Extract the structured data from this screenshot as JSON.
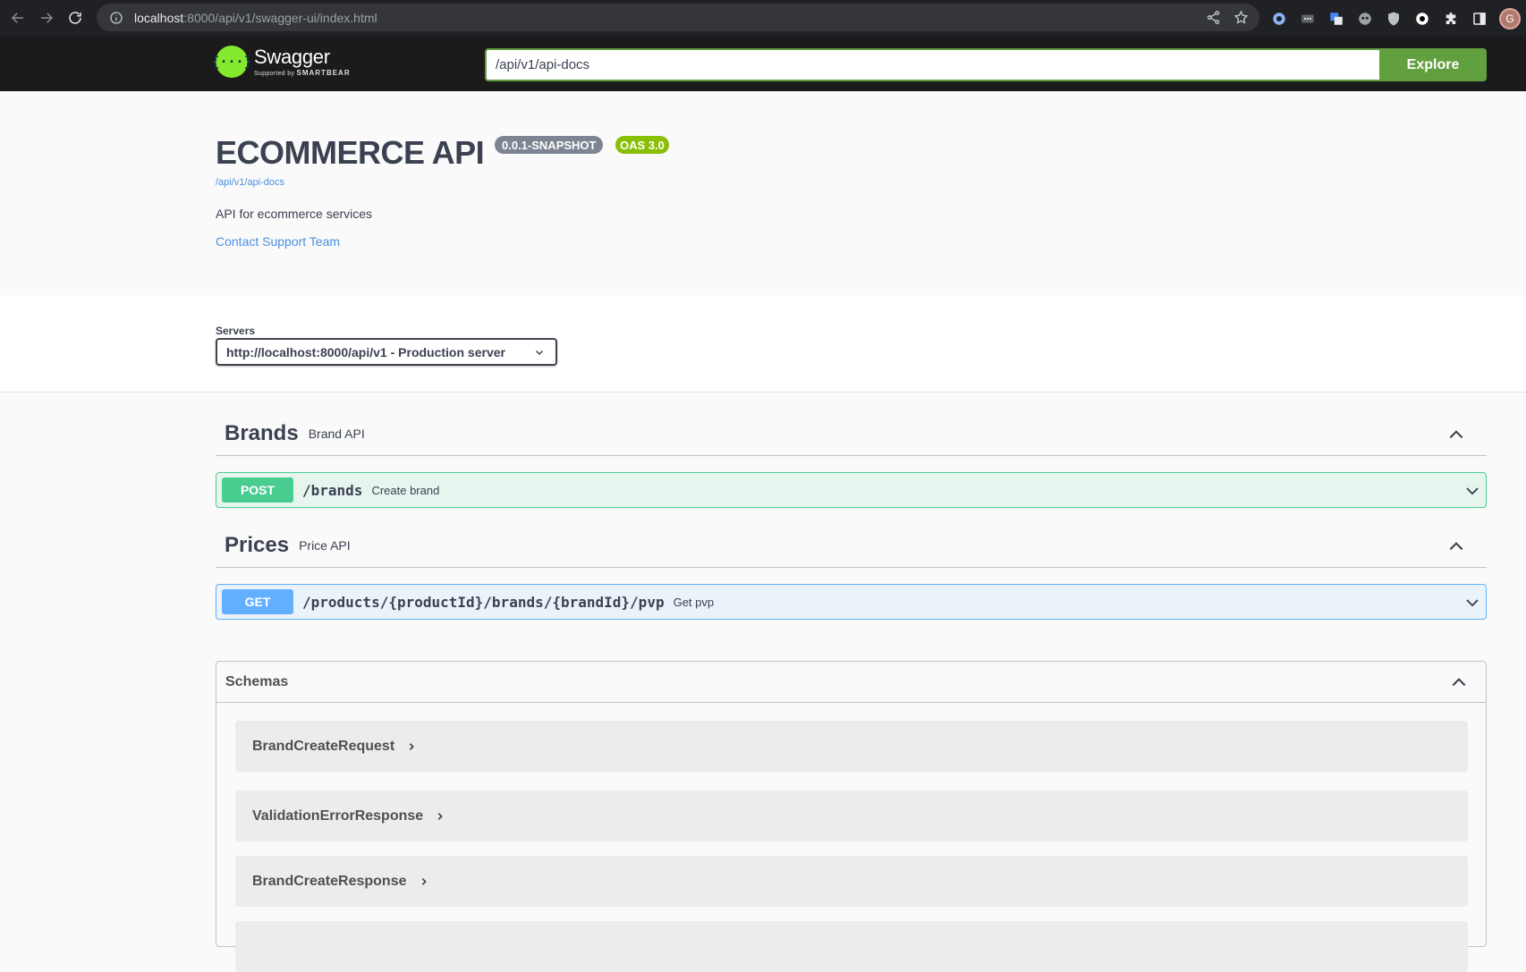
{
  "browser": {
    "url_host": "localhost",
    "url_rest": ":8000/api/v1/swagger-ui/index.html",
    "avatar_letter": "G"
  },
  "topbar": {
    "logo_name": "Swagger",
    "logo_sub_prefix": "Supported by",
    "logo_sub_brand": "SMARTBEAR",
    "explore_value": "/api/v1/api-docs",
    "explore_label": "Explore"
  },
  "info": {
    "title": "ECOMMERCE API",
    "version": "0.0.1-SNAPSHOT",
    "oas": "OAS 3.0",
    "docs_link": "/api/v1/api-docs",
    "description": "API for ecommerce services",
    "contact": "Contact Support Team"
  },
  "servers": {
    "label": "Servers",
    "selected": "http://localhost:8000/api/v1 - Production server"
  },
  "tags": [
    {
      "name": "Brands",
      "description": "Brand API",
      "operations": [
        {
          "method": "POST",
          "path": "/brands",
          "summary": "Create brand"
        }
      ]
    },
    {
      "name": "Prices",
      "description": "Price API",
      "operations": [
        {
          "method": "GET",
          "path": "/products/{productId}/brands/{brandId}/pvp",
          "summary": "Get pvp"
        }
      ]
    }
  ],
  "schemas": {
    "title": "Schemas",
    "items": [
      "BrandCreateRequest",
      "ValidationErrorResponse",
      "BrandCreateResponse"
    ]
  },
  "colors": {
    "post": "#49cc90",
    "get": "#61affe",
    "swagger_green": "#85ea2d",
    "explore_green": "#62a03f",
    "oas_badge": "#89bf04"
  }
}
